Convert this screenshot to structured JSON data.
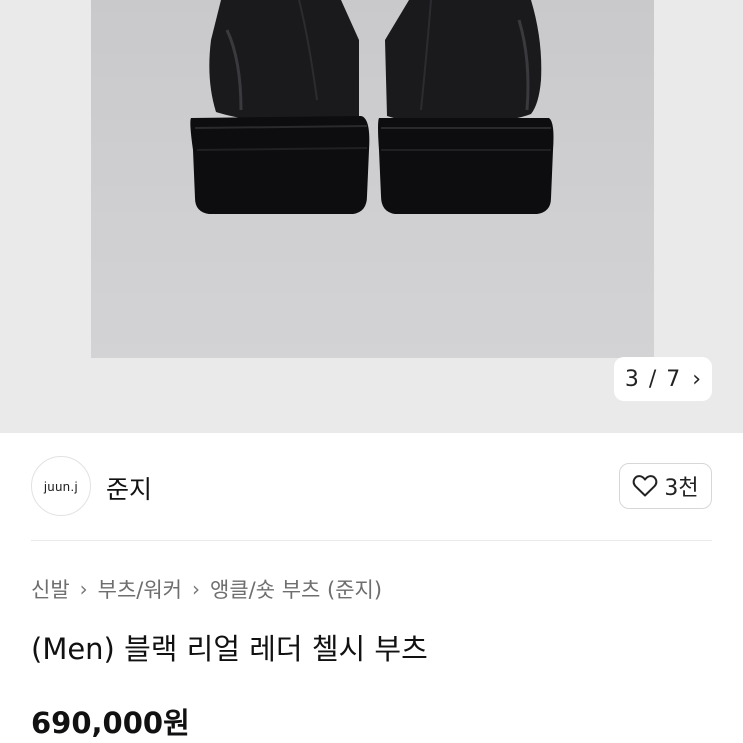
{
  "gallery": {
    "current": "3",
    "separator": "/",
    "total": "7",
    "next_icon": "chevron-right-icon",
    "background": "#eaeaea"
  },
  "seller": {
    "avatar_text": "juun.j",
    "name": "준지",
    "like_icon": "heart-outline-icon",
    "like_count": "3천"
  },
  "breadcrumb": {
    "items": [
      "신발",
      "부츠/워커",
      "앵클/숏 부츠 (준지)"
    ],
    "separator_icon": "chevron-right-icon"
  },
  "product": {
    "title": "(Men) 블랙 리얼 레더 첼시 부츠",
    "price": "690,000원"
  }
}
